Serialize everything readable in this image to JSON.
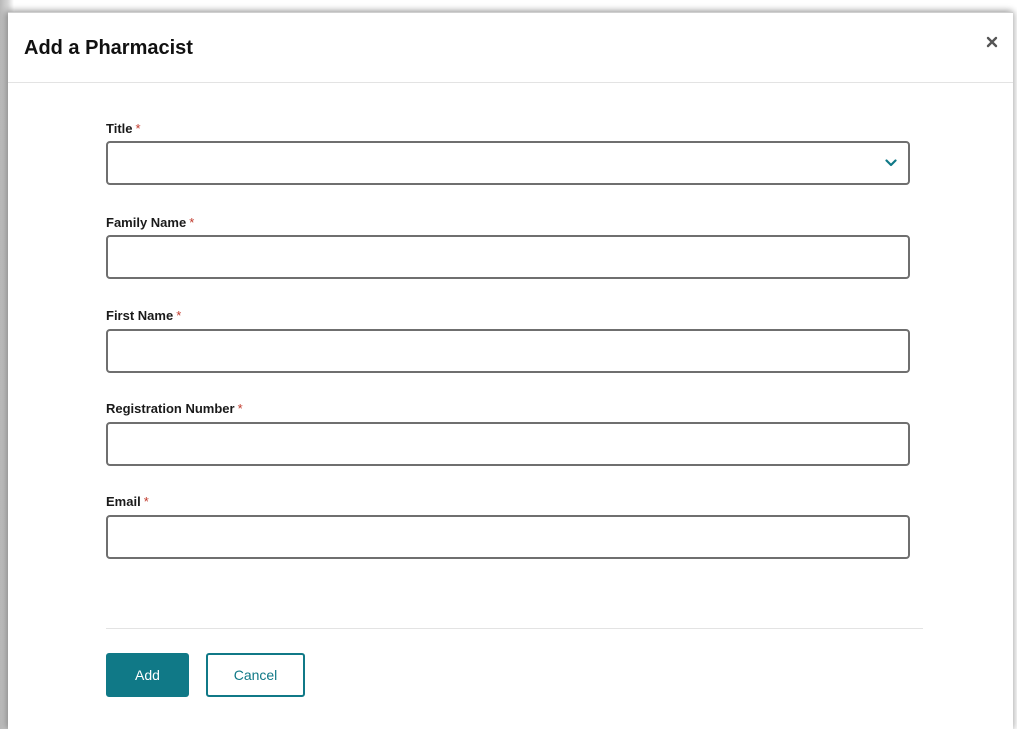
{
  "dialog": {
    "title": "Add a Pharmacist",
    "close_icon": "close-icon"
  },
  "form": {
    "required_marker": "*",
    "fields": [
      {
        "label": "Title",
        "type": "select",
        "value": "",
        "icon": "chevron-down-icon"
      },
      {
        "label": "Family Name",
        "type": "text",
        "value": ""
      },
      {
        "label": "First Name",
        "type": "text",
        "value": ""
      },
      {
        "label": "Registration Number",
        "type": "text",
        "value": ""
      },
      {
        "label": "Email",
        "type": "text",
        "value": ""
      }
    ]
  },
  "actions": {
    "add_label": "Add",
    "cancel_label": "Cancel"
  },
  "colors": {
    "accent": "#107987",
    "required": "#c0392b",
    "field_border": "#6f6f6f"
  }
}
